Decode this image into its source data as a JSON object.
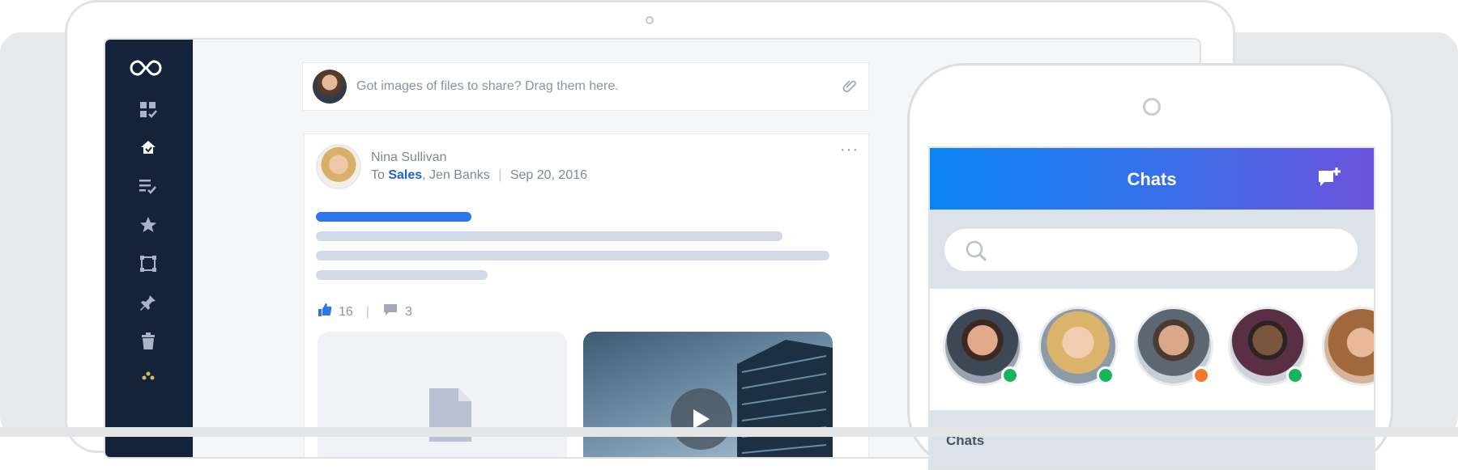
{
  "composer": {
    "placeholder": "Got images of files to share? Drag them here."
  },
  "post": {
    "author": "Nina Sullivan",
    "to_prefix": "To ",
    "to_link": "Sales",
    "to_rest": ", Jen Banks",
    "separator": "|",
    "date": "Sep 20, 2016",
    "more": "···",
    "likes": "16",
    "reaction_separator": "|",
    "comments": "3"
  },
  "phone": {
    "title": "Chats",
    "section_label": "Chats",
    "status_colors": {
      "online": "#19b35a",
      "away": "#f07a2b"
    }
  },
  "colors": {
    "sidebar": "#14233a",
    "accent": "#1d63c9"
  },
  "icons": [
    "logo-icon",
    "dashboard-icon",
    "home-icon",
    "tasks-icon",
    "star-icon",
    "selection-icon",
    "pin-icon",
    "trash-icon",
    "paperclip-icon",
    "thumbs-up-icon",
    "comment-icon",
    "file-icon",
    "play-icon",
    "new-chat-icon",
    "search-icon"
  ]
}
